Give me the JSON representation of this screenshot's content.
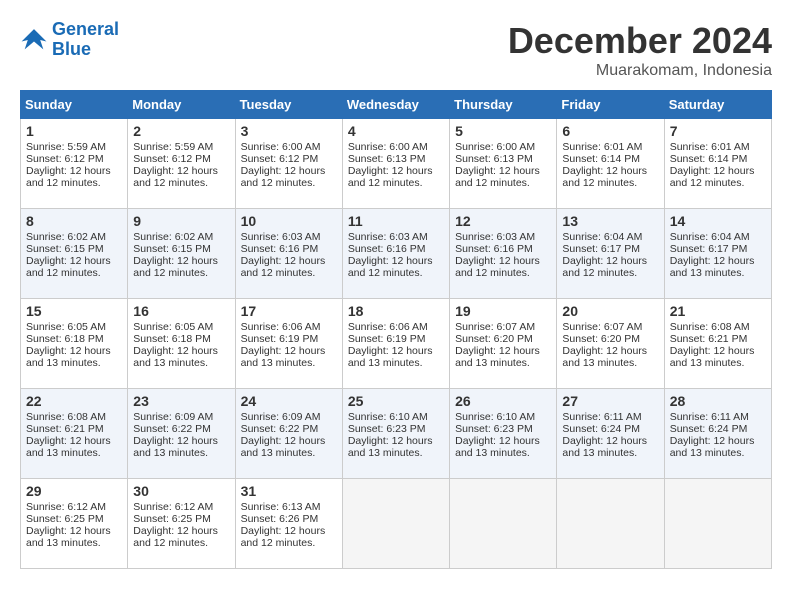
{
  "header": {
    "logo_line1": "General",
    "logo_line2": "Blue",
    "month": "December 2024",
    "location": "Muarakomam, Indonesia"
  },
  "days_of_week": [
    "Sunday",
    "Monday",
    "Tuesday",
    "Wednesday",
    "Thursday",
    "Friday",
    "Saturday"
  ],
  "weeks": [
    [
      {
        "day": 1,
        "lines": [
          "Sunrise: 5:59 AM",
          "Sunset: 6:12 PM",
          "Daylight: 12 hours",
          "and 12 minutes."
        ]
      },
      {
        "day": 2,
        "lines": [
          "Sunrise: 5:59 AM",
          "Sunset: 6:12 PM",
          "Daylight: 12 hours",
          "and 12 minutes."
        ]
      },
      {
        "day": 3,
        "lines": [
          "Sunrise: 6:00 AM",
          "Sunset: 6:12 PM",
          "Daylight: 12 hours",
          "and 12 minutes."
        ]
      },
      {
        "day": 4,
        "lines": [
          "Sunrise: 6:00 AM",
          "Sunset: 6:13 PM",
          "Daylight: 12 hours",
          "and 12 minutes."
        ]
      },
      {
        "day": 5,
        "lines": [
          "Sunrise: 6:00 AM",
          "Sunset: 6:13 PM",
          "Daylight: 12 hours",
          "and 12 minutes."
        ]
      },
      {
        "day": 6,
        "lines": [
          "Sunrise: 6:01 AM",
          "Sunset: 6:14 PM",
          "Daylight: 12 hours",
          "and 12 minutes."
        ]
      },
      {
        "day": 7,
        "lines": [
          "Sunrise: 6:01 AM",
          "Sunset: 6:14 PM",
          "Daylight: 12 hours",
          "and 12 minutes."
        ]
      }
    ],
    [
      {
        "day": 8,
        "lines": [
          "Sunrise: 6:02 AM",
          "Sunset: 6:15 PM",
          "Daylight: 12 hours",
          "and 12 minutes."
        ]
      },
      {
        "day": 9,
        "lines": [
          "Sunrise: 6:02 AM",
          "Sunset: 6:15 PM",
          "Daylight: 12 hours",
          "and 12 minutes."
        ]
      },
      {
        "day": 10,
        "lines": [
          "Sunrise: 6:03 AM",
          "Sunset: 6:16 PM",
          "Daylight: 12 hours",
          "and 12 minutes."
        ]
      },
      {
        "day": 11,
        "lines": [
          "Sunrise: 6:03 AM",
          "Sunset: 6:16 PM",
          "Daylight: 12 hours",
          "and 12 minutes."
        ]
      },
      {
        "day": 12,
        "lines": [
          "Sunrise: 6:03 AM",
          "Sunset: 6:16 PM",
          "Daylight: 12 hours",
          "and 12 minutes."
        ]
      },
      {
        "day": 13,
        "lines": [
          "Sunrise: 6:04 AM",
          "Sunset: 6:17 PM",
          "Daylight: 12 hours",
          "and 12 minutes."
        ]
      },
      {
        "day": 14,
        "lines": [
          "Sunrise: 6:04 AM",
          "Sunset: 6:17 PM",
          "Daylight: 12 hours",
          "and 13 minutes."
        ]
      }
    ],
    [
      {
        "day": 15,
        "lines": [
          "Sunrise: 6:05 AM",
          "Sunset: 6:18 PM",
          "Daylight: 12 hours",
          "and 13 minutes."
        ]
      },
      {
        "day": 16,
        "lines": [
          "Sunrise: 6:05 AM",
          "Sunset: 6:18 PM",
          "Daylight: 12 hours",
          "and 13 minutes."
        ]
      },
      {
        "day": 17,
        "lines": [
          "Sunrise: 6:06 AM",
          "Sunset: 6:19 PM",
          "Daylight: 12 hours",
          "and 13 minutes."
        ]
      },
      {
        "day": 18,
        "lines": [
          "Sunrise: 6:06 AM",
          "Sunset: 6:19 PM",
          "Daylight: 12 hours",
          "and 13 minutes."
        ]
      },
      {
        "day": 19,
        "lines": [
          "Sunrise: 6:07 AM",
          "Sunset: 6:20 PM",
          "Daylight: 12 hours",
          "and 13 minutes."
        ]
      },
      {
        "day": 20,
        "lines": [
          "Sunrise: 6:07 AM",
          "Sunset: 6:20 PM",
          "Daylight: 12 hours",
          "and 13 minutes."
        ]
      },
      {
        "day": 21,
        "lines": [
          "Sunrise: 6:08 AM",
          "Sunset: 6:21 PM",
          "Daylight: 12 hours",
          "and 13 minutes."
        ]
      }
    ],
    [
      {
        "day": 22,
        "lines": [
          "Sunrise: 6:08 AM",
          "Sunset: 6:21 PM",
          "Daylight: 12 hours",
          "and 13 minutes."
        ]
      },
      {
        "day": 23,
        "lines": [
          "Sunrise: 6:09 AM",
          "Sunset: 6:22 PM",
          "Daylight: 12 hours",
          "and 13 minutes."
        ]
      },
      {
        "day": 24,
        "lines": [
          "Sunrise: 6:09 AM",
          "Sunset: 6:22 PM",
          "Daylight: 12 hours",
          "and 13 minutes."
        ]
      },
      {
        "day": 25,
        "lines": [
          "Sunrise: 6:10 AM",
          "Sunset: 6:23 PM",
          "Daylight: 12 hours",
          "and 13 minutes."
        ]
      },
      {
        "day": 26,
        "lines": [
          "Sunrise: 6:10 AM",
          "Sunset: 6:23 PM",
          "Daylight: 12 hours",
          "and 13 minutes."
        ]
      },
      {
        "day": 27,
        "lines": [
          "Sunrise: 6:11 AM",
          "Sunset: 6:24 PM",
          "Daylight: 12 hours",
          "and 13 minutes."
        ]
      },
      {
        "day": 28,
        "lines": [
          "Sunrise: 6:11 AM",
          "Sunset: 6:24 PM",
          "Daylight: 12 hours",
          "and 13 minutes."
        ]
      }
    ],
    [
      {
        "day": 29,
        "lines": [
          "Sunrise: 6:12 AM",
          "Sunset: 6:25 PM",
          "Daylight: 12 hours",
          "and 13 minutes."
        ]
      },
      {
        "day": 30,
        "lines": [
          "Sunrise: 6:12 AM",
          "Sunset: 6:25 PM",
          "Daylight: 12 hours",
          "and 12 minutes."
        ]
      },
      {
        "day": 31,
        "lines": [
          "Sunrise: 6:13 AM",
          "Sunset: 6:26 PM",
          "Daylight: 12 hours",
          "and 12 minutes."
        ]
      },
      null,
      null,
      null,
      null
    ]
  ]
}
